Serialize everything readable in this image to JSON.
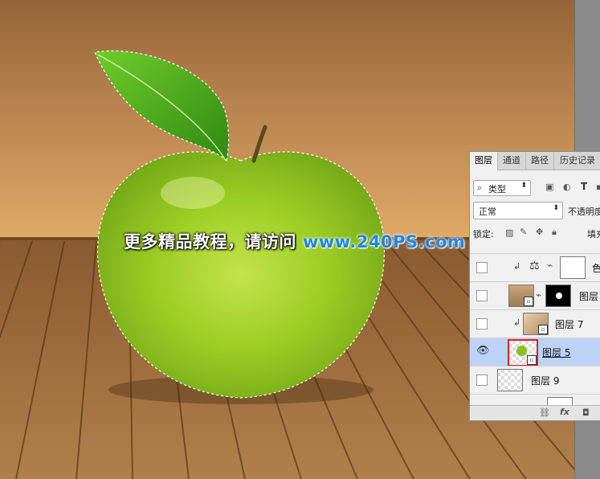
{
  "watermark": {
    "cn": "更多精品教程，请访问",
    "url": "www.240PS.com"
  },
  "layers_panel": {
    "tabs": [
      {
        "label": "图层",
        "active": true
      },
      {
        "label": "通道",
        "active": false
      },
      {
        "label": "路径",
        "active": false
      },
      {
        "label": "历史记录",
        "active": false
      }
    ],
    "filter_kind": "类型",
    "blend_mode": "正常",
    "opacity_label": "不透明度",
    "lock_label": "锁定:",
    "fill_label": "填充",
    "layers": [
      {
        "name": "色",
        "visible": false,
        "selected": false,
        "type": "adjustment"
      },
      {
        "name": "图层",
        "visible": false,
        "selected": false,
        "type": "masked"
      },
      {
        "name": "图层 7",
        "visible": false,
        "selected": false,
        "type": "clipped"
      },
      {
        "name": "图层 5",
        "visible": true,
        "selected": true,
        "type": "smart"
      },
      {
        "name": "图层 9",
        "visible": false,
        "selected": false,
        "type": "empty"
      }
    ],
    "bottom_icons": [
      "link-icon",
      "fx-icon",
      "mask-icon"
    ],
    "bottom_fx": "fx"
  },
  "colors": {
    "wall_top": "#9a6a3e",
    "wall_bottom": "#dba868",
    "floor": "#9a6a3a",
    "apple_green": "#8cc21e",
    "selection_highlight": "#bcd3f6",
    "thumbnail_highlight": "#e0202a",
    "url_blue": "#1f87e4"
  }
}
